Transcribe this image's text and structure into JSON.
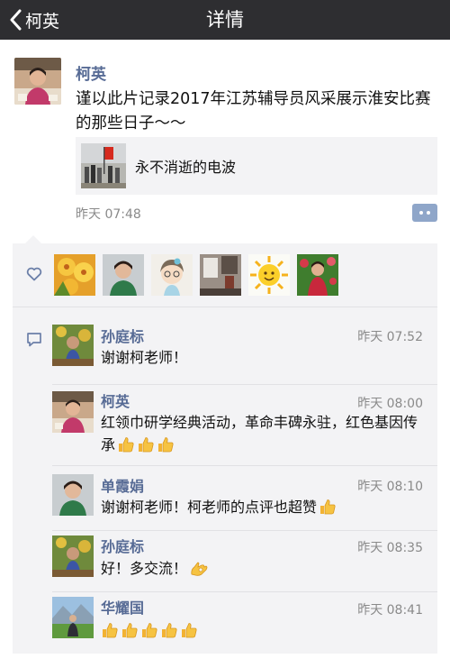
{
  "nav": {
    "back_label": "柯英",
    "title": "详情"
  },
  "post": {
    "author": "柯英",
    "text": "谨以此片记录2017年江苏辅导员风采展示淮安比赛的那些日子～～",
    "link_title": "永不消逝的电波",
    "time": "昨天 07:48"
  },
  "comments": [
    {
      "name": "孙庭标",
      "time": "昨天 07:52",
      "text": "谢谢柯老师！"
    },
    {
      "name": "柯英",
      "time": "昨天 08:00",
      "text": "红领巾研学经典活动，革命丰碑永驻，红色基因传承"
    },
    {
      "name": "单霞娟",
      "time": "昨天 08:10",
      "text": "谢谢柯老师！柯老师的点评也超赞"
    },
    {
      "name": "孙庭标",
      "time": "昨天 08:35",
      "text": "好！多交流！"
    },
    {
      "name": "华耀国",
      "time": "昨天 08:41",
      "text": ""
    }
  ],
  "colors": {
    "navbar": "#2e2e31",
    "name_link": "#576b95",
    "panel_bg": "#f3f3f5",
    "time_gray": "#8a8a8a"
  },
  "icons": {
    "back": "chevron-left-icon",
    "like": "heart-outline-icon",
    "comment": "comment-bubble-icon",
    "more": "more-dots-icon",
    "thumbs_up": "thumbs-up-emoji",
    "ok_hand": "ok-hand-emoji"
  }
}
